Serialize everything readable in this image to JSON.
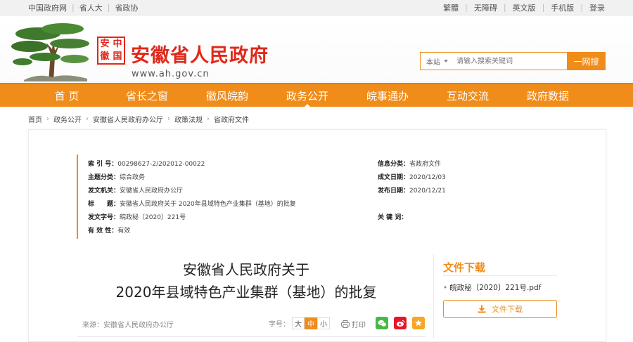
{
  "topbar": {
    "links": [
      "中国政府网",
      "省人大",
      "省政协"
    ],
    "right": [
      "繁體",
      "无障碍",
      "英文版",
      "手机版",
      "登录"
    ]
  },
  "header": {
    "seal_chars": [
      "安",
      "中",
      "徽",
      "国"
    ],
    "site_title": "安徽省人民政府",
    "site_url": "www.ah.gov.cn"
  },
  "search": {
    "scope": "本站",
    "placeholder": "请输入搜索关键词",
    "button": "一网搜"
  },
  "nav": {
    "items": [
      "首 页",
      "省长之窗",
      "徽风皖韵",
      "政务公开",
      "皖事通办",
      "互动交流",
      "政府数据"
    ],
    "active_index": 3
  },
  "breadcrumb": [
    "首页",
    "政务公开",
    "安徽省人民政府办公厅",
    "政策法规",
    "省政府文件"
  ],
  "meta": {
    "index_no": {
      "k": "索 引 号：",
      "v": "00298627-2/202012-00022"
    },
    "info_type": {
      "k": "信息分类：",
      "v": "省政府文件"
    },
    "subject": {
      "k": "主题分类：",
      "v": "综合政务"
    },
    "created": {
      "k": "成文日期：",
      "v": "2020/12/03"
    },
    "issuer": {
      "k": "发文机关：",
      "v": "安徽省人民政府办公厅"
    },
    "published": {
      "k": "发布日期：",
      "v": "2020/12/21"
    },
    "title": {
      "k": "标　　题：",
      "v": "安徽省人民政府关于 2020年县域特色产业集群（基地）的批复"
    },
    "doc_no": {
      "k": "发文字号：",
      "v": "皖政秘〔2020〕221号"
    },
    "keywords": {
      "k": "关 键 词：",
      "v": ""
    },
    "validity": {
      "k": "有 效 性：",
      "v": "有效"
    }
  },
  "document": {
    "title_line1": "安徽省人民政府关于",
    "title_line2": "2020年县域特色产业集群（基地）的批复",
    "source": "来源：安徽省人民政府办公厅",
    "font_label": "字号：",
    "font_sizes": [
      "大",
      "中",
      "小"
    ],
    "font_active": "中",
    "print": "打印"
  },
  "download": {
    "title": "文件下载",
    "file": "皖政秘〔2020〕221号.pdf",
    "button": "文件下载"
  },
  "colors": {
    "brand_orange": "#f08c1a",
    "brand_red": "#e0281a"
  }
}
